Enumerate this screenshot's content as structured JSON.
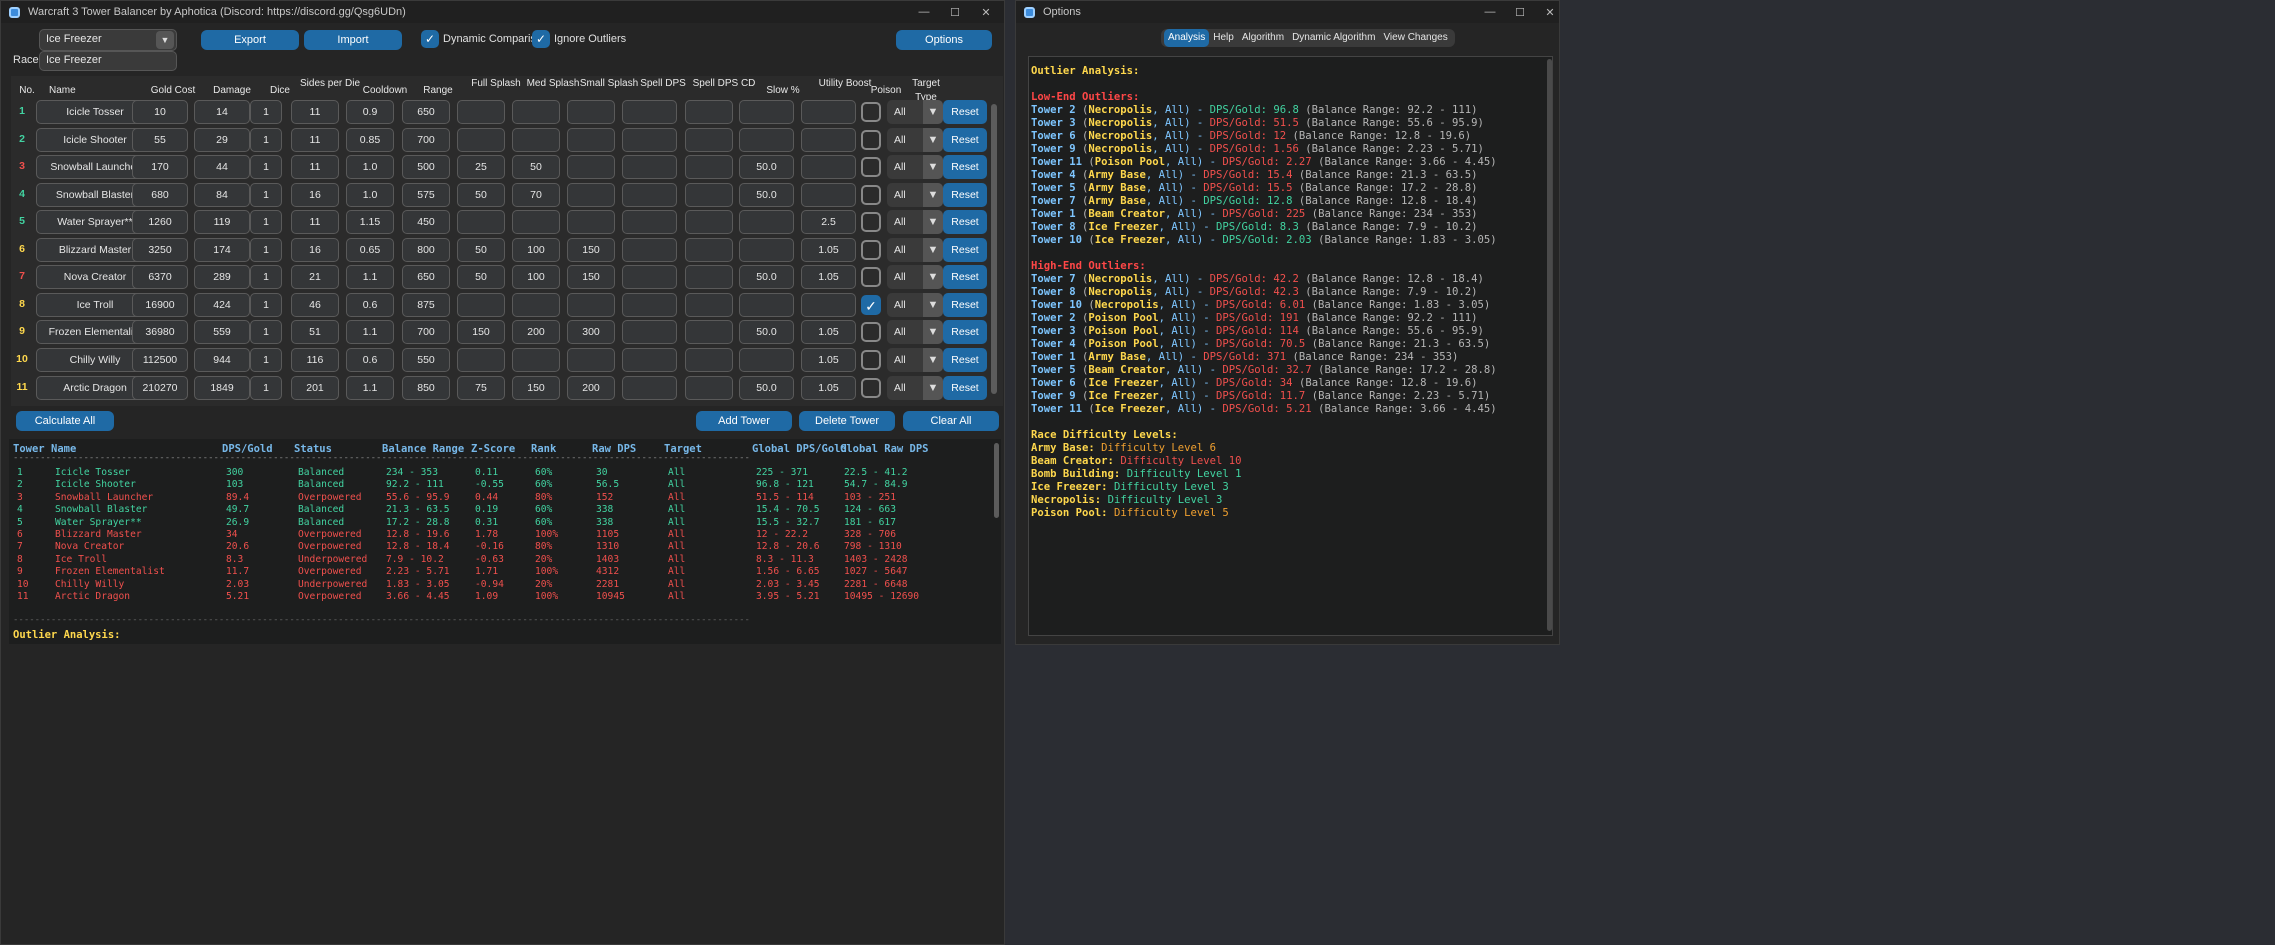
{
  "colors": {
    "accent": "#1f6aa5",
    "balanced": "#42d3a1",
    "over": "#f0504d",
    "under": "#f0504d",
    "heading_yellow": "#ffd84d",
    "heading_red": "#ff4747",
    "tower_blue": "#7ec6ff",
    "gray_text": "#b6b6b6"
  },
  "main_window": {
    "title": "Warcraft 3 Tower Balancer by Aphotica (Discord: https://discord.gg/Qsg6UDn)",
    "controls": [
      "minimize",
      "maximize",
      "close"
    ]
  },
  "top": {
    "race_select": "Ice Freezer",
    "race_label": "Race:",
    "race_input": "Ice Freezer",
    "export": "Export",
    "import": "Import",
    "dynamic_comparison": "Dynamic Comparison",
    "ignore_outliers": "Ignore Outliers",
    "options": "Options"
  },
  "columns": [
    "No.",
    "Name",
    "Gold Cost",
    "Damage",
    "Dice",
    "Sides per Die",
    "Cooldown",
    "Range",
    "Full Splash",
    "Med Splash",
    "Small Splash",
    "Spell DPS",
    "Spell DPS CD",
    "Slow %",
    "Utility Boost",
    "Poison",
    "Target Type"
  ],
  "towers": [
    {
      "no": "1",
      "name": "Icicle Tosser",
      "gold": "10",
      "damage": "14",
      "dice": "1",
      "sides": "11",
      "cd": "0.9",
      "range": "650",
      "full": "",
      "med": "",
      "small": "",
      "spell": "",
      "spellcd": "",
      "slow": "",
      "util": "",
      "poison": false,
      "target": "All",
      "color": "#42d3a1"
    },
    {
      "no": "2",
      "name": "Icicle Shooter",
      "gold": "55",
      "damage": "29",
      "dice": "1",
      "sides": "11",
      "cd": "0.85",
      "range": "700",
      "full": "",
      "med": "",
      "small": "",
      "spell": "",
      "spellcd": "",
      "slow": "",
      "util": "",
      "poison": false,
      "target": "All",
      "color": "#42d3a1"
    },
    {
      "no": "3",
      "name": "Snowball Launcher",
      "gold": "170",
      "damage": "44",
      "dice": "1",
      "sides": "11",
      "cd": "1.0",
      "range": "500",
      "full": "25",
      "med": "50",
      "small": "",
      "spell": "",
      "spellcd": "",
      "slow": "50.0",
      "util": "",
      "poison": false,
      "target": "All",
      "color": "#f0504d"
    },
    {
      "no": "4",
      "name": "Snowball Blaster",
      "gold": "680",
      "damage": "84",
      "dice": "1",
      "sides": "16",
      "cd": "1.0",
      "range": "575",
      "full": "50",
      "med": "70",
      "small": "",
      "spell": "",
      "spellcd": "",
      "slow": "50.0",
      "util": "",
      "poison": false,
      "target": "All",
      "color": "#42d3a1"
    },
    {
      "no": "5",
      "name": "Water Sprayer**",
      "gold": "1260",
      "damage": "119",
      "dice": "1",
      "sides": "11",
      "cd": "1.15",
      "range": "450",
      "full": "",
      "med": "",
      "small": "",
      "spell": "",
      "spellcd": "",
      "slow": "",
      "util": "2.5",
      "poison": false,
      "target": "All",
      "color": "#42d3a1"
    },
    {
      "no": "6",
      "name": "Blizzard Master",
      "gold": "3250",
      "damage": "174",
      "dice": "1",
      "sides": "16",
      "cd": "0.65",
      "range": "800",
      "full": "50",
      "med": "100",
      "small": "150",
      "spell": "",
      "spellcd": "",
      "slow": "",
      "util": "1.05",
      "poison": false,
      "target": "All",
      "color": "#ffd84d"
    },
    {
      "no": "7",
      "name": "Nova Creator",
      "gold": "6370",
      "damage": "289",
      "dice": "1",
      "sides": "21",
      "cd": "1.1",
      "range": "650",
      "full": "50",
      "med": "100",
      "small": "150",
      "spell": "",
      "spellcd": "",
      "slow": "50.0",
      "util": "1.05",
      "poison": false,
      "target": "All",
      "color": "#f0504d"
    },
    {
      "no": "8",
      "name": "Ice Troll",
      "gold": "16900",
      "damage": "424",
      "dice": "1",
      "sides": "46",
      "cd": "0.6",
      "range": "875",
      "full": "",
      "med": "",
      "small": "",
      "spell": "",
      "spellcd": "",
      "slow": "",
      "util": "",
      "poison": true,
      "target": "All",
      "color": "#ffd84d"
    },
    {
      "no": "9",
      "name": "Frozen Elementalist",
      "gold": "36980",
      "damage": "559",
      "dice": "1",
      "sides": "51",
      "cd": "1.1",
      "range": "700",
      "full": "150",
      "med": "200",
      "small": "300",
      "spell": "",
      "spellcd": "",
      "slow": "50.0",
      "util": "1.05",
      "poison": false,
      "target": "All",
      "color": "#ffd84d"
    },
    {
      "no": "10",
      "name": "Chilly Willy",
      "gold": "112500",
      "damage": "944",
      "dice": "1",
      "sides": "116",
      "cd": "0.6",
      "range": "550",
      "full": "",
      "med": "",
      "small": "",
      "spell": "",
      "spellcd": "",
      "slow": "",
      "util": "1.05",
      "poison": false,
      "target": "All",
      "color": "#ffd84d"
    },
    {
      "no": "11",
      "name": "Arctic Dragon",
      "gold": "210270",
      "damage": "1849",
      "dice": "1",
      "sides": "201",
      "cd": "1.1",
      "range": "850",
      "full": "75",
      "med": "150",
      "small": "200",
      "spell": "",
      "spellcd": "",
      "slow": "50.0",
      "util": "1.05",
      "poison": false,
      "target": "All",
      "color": "#ffd84d"
    }
  ],
  "reset_label": "Reset",
  "actions": {
    "calculate": "Calculate All",
    "add": "Add Tower",
    "delete": "Delete Tower",
    "clear": "Clear All"
  },
  "results_headers": [
    "Tower",
    "Name",
    "DPS/Gold",
    "Status",
    "Balance Range",
    "Z-Score",
    "Rank",
    "Raw DPS",
    "Target",
    "Global DPS/Gold",
    "Global Raw DPS"
  ],
  "results_divider": "----------------------------------------------------------------------------------------------------------------------------------------",
  "results": [
    [
      "1",
      "Icicle Tosser",
      "300",
      "Balanced",
      "234 - 353",
      "0.11",
      "60%",
      "30",
      "All",
      "225 - 371",
      "22.5 - 41.2",
      "b"
    ],
    [
      "2",
      "Icicle Shooter",
      "103",
      "Balanced",
      "92.2 - 111",
      "-0.55",
      "60%",
      "56.5",
      "All",
      "96.8 - 121",
      "54.7 - 84.9",
      "b"
    ],
    [
      "3",
      "Snowball Launcher",
      "89.4",
      "Overpowered",
      "55.6 - 95.9",
      "0.44",
      "80%",
      "152",
      "All",
      "51.5 - 114",
      "103 - 251",
      "o"
    ],
    [
      "4",
      "Snowball Blaster",
      "49.7",
      "Balanced",
      "21.3 - 63.5",
      "0.19",
      "60%",
      "338",
      "All",
      "15.4 - 70.5",
      "124 - 663",
      "b"
    ],
    [
      "5",
      "Water Sprayer**",
      "26.9",
      "Balanced",
      "17.2 - 28.8",
      "0.31",
      "60%",
      "338",
      "All",
      "15.5 - 32.7",
      "181 - 617",
      "b"
    ],
    [
      "6",
      "Blizzard Master",
      "34",
      "Overpowered",
      "12.8 - 19.6",
      "1.78",
      "100%",
      "1105",
      "All",
      "12 - 22.2",
      "328 - 706",
      "o"
    ],
    [
      "7",
      "Nova Creator",
      "20.6",
      "Overpowered",
      "12.8 - 18.4",
      "-0.16",
      "80%",
      "1310",
      "All",
      "12.8 - 20.6",
      "798 - 1310",
      "o"
    ],
    [
      "8",
      "Ice Troll",
      "8.3",
      "Underpowered",
      "7.9 - 10.2",
      "-0.63",
      "20%",
      "1403",
      "All",
      "8.3 - 11.3",
      "1403 - 2428",
      "o"
    ],
    [
      "9",
      "Frozen Elementalist",
      "11.7",
      "Overpowered",
      "2.23 - 5.71",
      "1.71",
      "100%",
      "4312",
      "All",
      "1.56 - 6.65",
      "1027 - 5647",
      "o"
    ],
    [
      "10",
      "Chilly Willy",
      "2.03",
      "Underpowered",
      "1.83 - 3.05",
      "-0.94",
      "20%",
      "2281",
      "All",
      "2.03 - 3.45",
      "2281 - 6648",
      "o"
    ],
    [
      "11",
      "Arctic Dragon",
      "5.21",
      "Overpowered",
      "3.66 - 4.45",
      "1.09",
      "100%",
      "10945",
      "All",
      "3.95 - 5.21",
      "10495 - 12690",
      "o"
    ]
  ],
  "results_footer": "Outlier Analysis:",
  "options_window": {
    "title": "Options",
    "tabs": [
      "Analysis",
      "Help",
      "Algorithm",
      "Dynamic Algorithm",
      "View Changes"
    ],
    "active_tab": "Analysis"
  },
  "analysis": {
    "title": "Outlier Analysis:",
    "low_title": "Low-End Outliers:",
    "low": [
      {
        "t": "Tower 2",
        "race": "Necropolis",
        "dps": "DPS/Gold: 96.8",
        "range": "(Balance Range: 92.2 - 111)",
        "c": "b"
      },
      {
        "t": "Tower 3",
        "race": "Necropolis",
        "dps": "DPS/Gold: 51.5",
        "range": "(Balance Range: 55.6 - 95.9)",
        "c": "o"
      },
      {
        "t": "Tower 6",
        "race": "Necropolis",
        "dps": "DPS/Gold: 12",
        "range": "(Balance Range: 12.8 - 19.6)",
        "c": "o"
      },
      {
        "t": "Tower 9",
        "race": "Necropolis",
        "dps": "DPS/Gold: 1.56",
        "range": "(Balance Range: 2.23 - 5.71)",
        "c": "o"
      },
      {
        "t": "Tower 11",
        "race": "Poison Pool",
        "dps": "DPS/Gold: 2.27",
        "range": "(Balance Range: 3.66 - 4.45)",
        "c": "o"
      },
      {
        "t": "Tower 4",
        "race": "Army Base",
        "dps": "DPS/Gold: 15.4",
        "range": "(Balance Range: 21.3 - 63.5)",
        "c": "o"
      },
      {
        "t": "Tower 5",
        "race": "Army Base",
        "dps": "DPS/Gold: 15.5",
        "range": "(Balance Range: 17.2 - 28.8)",
        "c": "o"
      },
      {
        "t": "Tower 7",
        "race": "Army Base",
        "dps": "DPS/Gold: 12.8",
        "range": "(Balance Range: 12.8 - 18.4)",
        "c": "b"
      },
      {
        "t": "Tower 1",
        "race": "Beam Creator",
        "dps": "DPS/Gold: 225",
        "range": "(Balance Range: 234 - 353)",
        "c": "o"
      },
      {
        "t": "Tower 8",
        "race": "Ice Freezer",
        "dps": "DPS/Gold: 8.3",
        "range": "(Balance Range: 7.9 - 10.2)",
        "c": "b"
      },
      {
        "t": "Tower 10",
        "race": "Ice Freezer",
        "dps": "DPS/Gold: 2.03",
        "range": "(Balance Range: 1.83 - 3.05)",
        "c": "b"
      }
    ],
    "high_title": "High-End Outliers:",
    "high": [
      {
        "t": "Tower 7",
        "race": "Necropolis",
        "dps": "DPS/Gold: 42.2",
        "range": "(Balance Range: 12.8 - 18.4)",
        "c": "o"
      },
      {
        "t": "Tower 8",
        "race": "Necropolis",
        "dps": "DPS/Gold: 42.3",
        "range": "(Balance Range: 7.9 - 10.2)",
        "c": "o"
      },
      {
        "t": "Tower 10",
        "race": "Necropolis",
        "dps": "DPS/Gold: 6.01",
        "range": "(Balance Range: 1.83 - 3.05)",
        "c": "o"
      },
      {
        "t": "Tower 2",
        "race": "Poison Pool",
        "dps": "DPS/Gold: 191",
        "range": "(Balance Range: 92.2 - 111)",
        "c": "o"
      },
      {
        "t": "Tower 3",
        "race": "Poison Pool",
        "dps": "DPS/Gold: 114",
        "range": "(Balance Range: 55.6 - 95.9)",
        "c": "o"
      },
      {
        "t": "Tower 4",
        "race": "Poison Pool",
        "dps": "DPS/Gold: 70.5",
        "range": "(Balance Range: 21.3 - 63.5)",
        "c": "o"
      },
      {
        "t": "Tower 1",
        "race": "Army Base",
        "dps": "DPS/Gold: 371",
        "range": "(Balance Range: 234 - 353)",
        "c": "o"
      },
      {
        "t": "Tower 5",
        "race": "Beam Creator",
        "dps": "DPS/Gold: 32.7",
        "range": "(Balance Range: 17.2 - 28.8)",
        "c": "o"
      },
      {
        "t": "Tower 6",
        "race": "Ice Freezer",
        "dps": "DPS/Gold: 34",
        "range": "(Balance Range: 12.8 - 19.6)",
        "c": "o"
      },
      {
        "t": "Tower 9",
        "race": "Ice Freezer",
        "dps": "DPS/Gold: 11.7",
        "range": "(Balance Range: 2.23 - 5.71)",
        "c": "o"
      },
      {
        "t": "Tower 11",
        "race": "Ice Freezer",
        "dps": "DPS/Gold: 5.21",
        "range": "(Balance Range: 3.66 - 4.45)",
        "c": "o"
      }
    ],
    "diff_title": "Race Difficulty Levels:",
    "difficulty": [
      {
        "race": "Army Base:",
        "level": "Difficulty Level 6",
        "c": "#f0a030"
      },
      {
        "race": "Beam Creator:",
        "level": "Difficulty Level 10",
        "c": "#f0504d"
      },
      {
        "race": "Bomb Building:",
        "level": "Difficulty Level 1",
        "c": "#42d3a1"
      },
      {
        "race": "Ice Freezer:",
        "level": "Difficulty Level 3",
        "c": "#42d3a1"
      },
      {
        "race": "Necropolis:",
        "level": "Difficulty Level 3",
        "c": "#42d3a1"
      },
      {
        "race": "Poison Pool:",
        "level": "Difficulty Level 5",
        "c": "#f0a030"
      }
    ]
  }
}
